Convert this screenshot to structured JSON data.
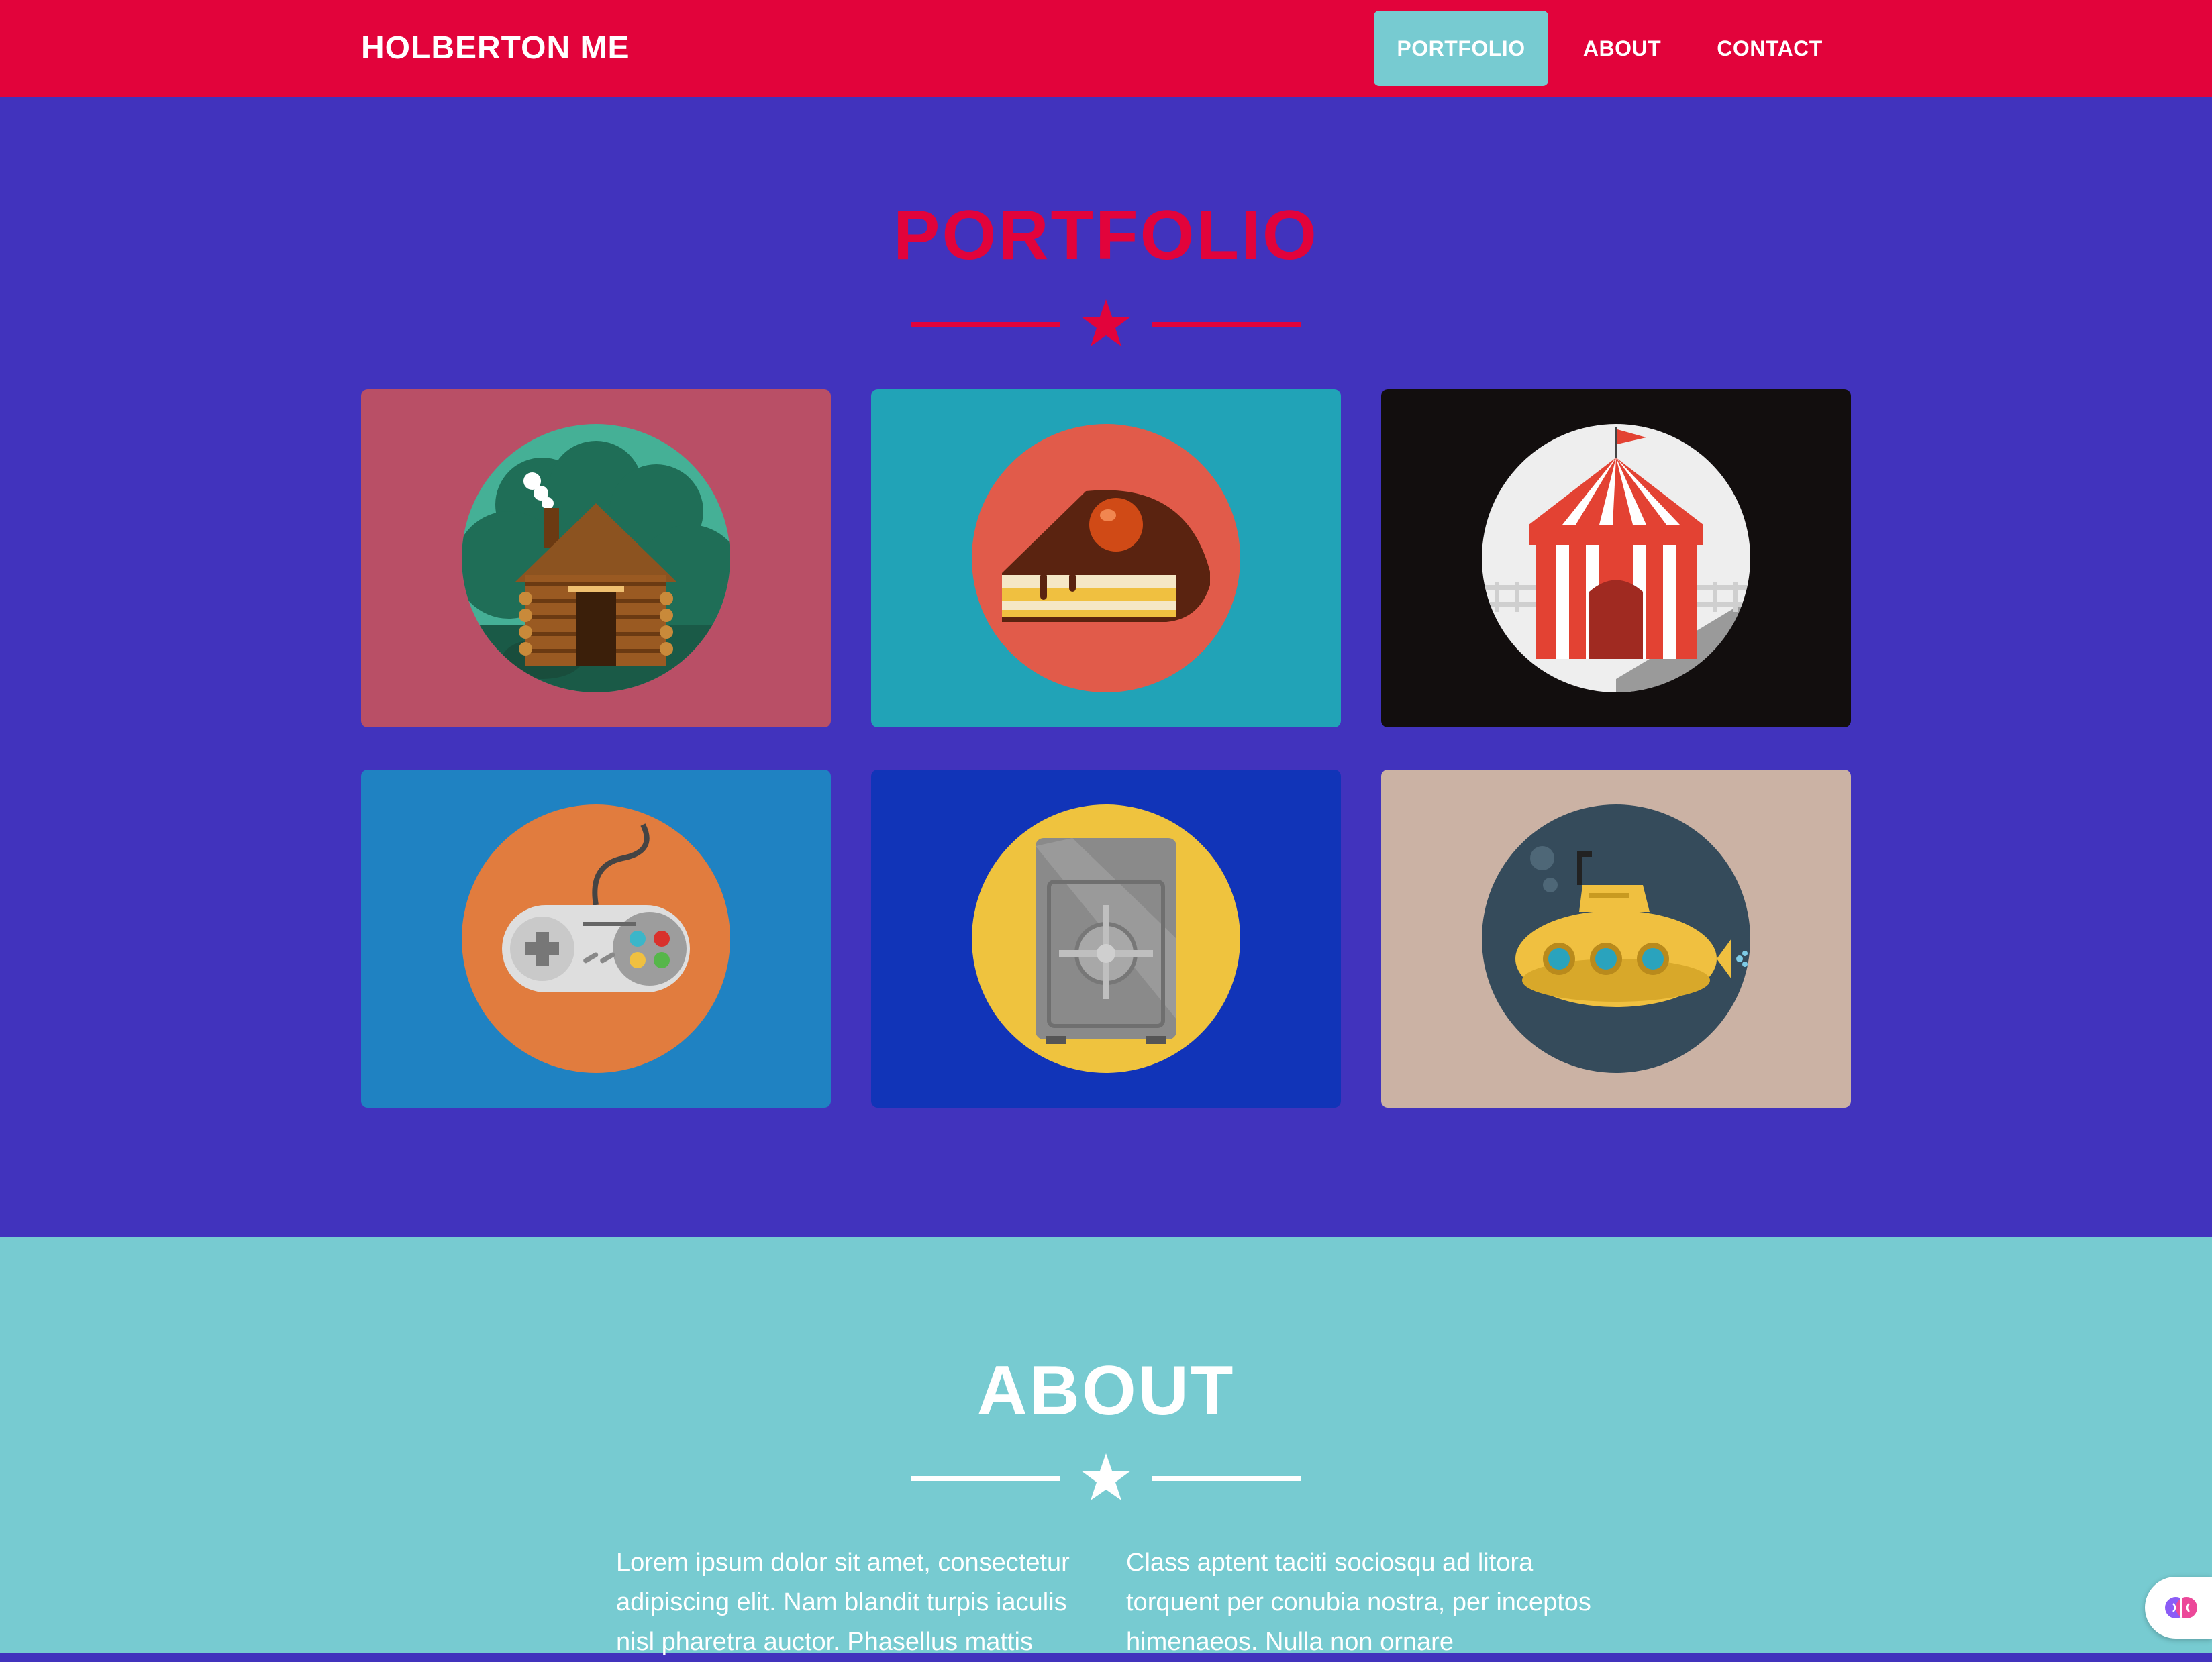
{
  "navbar": {
    "brand": "HOLBERTON ME",
    "items": [
      {
        "label": "PORTFOLIO",
        "active": true
      },
      {
        "label": "ABOUT",
        "active": false
      },
      {
        "label": "CONTACT",
        "active": false
      }
    ]
  },
  "portfolio": {
    "title": "PORTFOLIO",
    "items": [
      {
        "icon": "cabin-icon",
        "background": "#b94f66"
      },
      {
        "icon": "cake-icon",
        "background": "#21a3b7"
      },
      {
        "icon": "circus-tent-icon",
        "background": "#120e0e"
      },
      {
        "icon": "game-controller-icon",
        "background": "#1f82c2"
      },
      {
        "icon": "safe-icon",
        "background": "#1134b8"
      },
      {
        "icon": "submarine-icon",
        "background": "#cbb2a4"
      }
    ]
  },
  "about": {
    "title": "ABOUT",
    "col1": "Lorem ipsum dolor sit amet, consectetur adipiscing elit. Nam blandit turpis iaculis nisl pharetra auctor. Phasellus mattis",
    "col2": "Class aptent taciti sociosqu ad litora torquent per conubia nostra, per inceptos himenaeos. Nulla non ornare"
  },
  "colors": {
    "navbar": "#e2033b",
    "portfolio_bg": "#4133bd",
    "about_bg": "#77cbd1",
    "accent": "#e2033b",
    "active_nav": "#77cbd1"
  },
  "extension_badge": {
    "icon": "brain-icon"
  }
}
